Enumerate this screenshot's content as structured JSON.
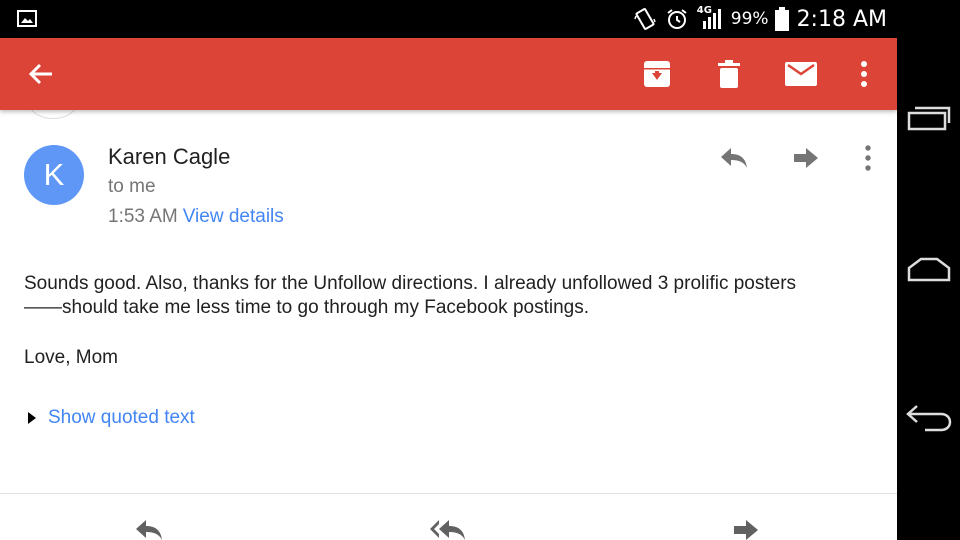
{
  "status_bar": {
    "network_label": "4G",
    "battery_percent": "99%",
    "time": "2:18 AM"
  },
  "toolbar": {
    "back_icon": "arrow-left-icon",
    "archive_icon": "archive-icon",
    "delete_icon": "trash-icon",
    "mark_unread_icon": "mail-icon",
    "more_icon": "more-vert-icon",
    "color": "#db4437"
  },
  "message": {
    "avatar_letter": "K",
    "avatar_color": "#5e97f6",
    "sender": "Karen Cagle",
    "recipient": "to me",
    "time": "1:53 AM",
    "view_details": "View details",
    "body_line1": "Sounds good.  Also, thanks for the Unfollow directions.  I already unfollowed 3 prolific posters",
    "body_line2": "——should take me less time to go through my Facebook postings.",
    "signoff": "Love, Mom",
    "show_quoted": "Show quoted text"
  },
  "footer_actions": [
    "reply-icon",
    "reply-all-icon",
    "forward-icon"
  ],
  "nav_bar": [
    "recents-icon",
    "home-icon",
    "back-icon"
  ]
}
